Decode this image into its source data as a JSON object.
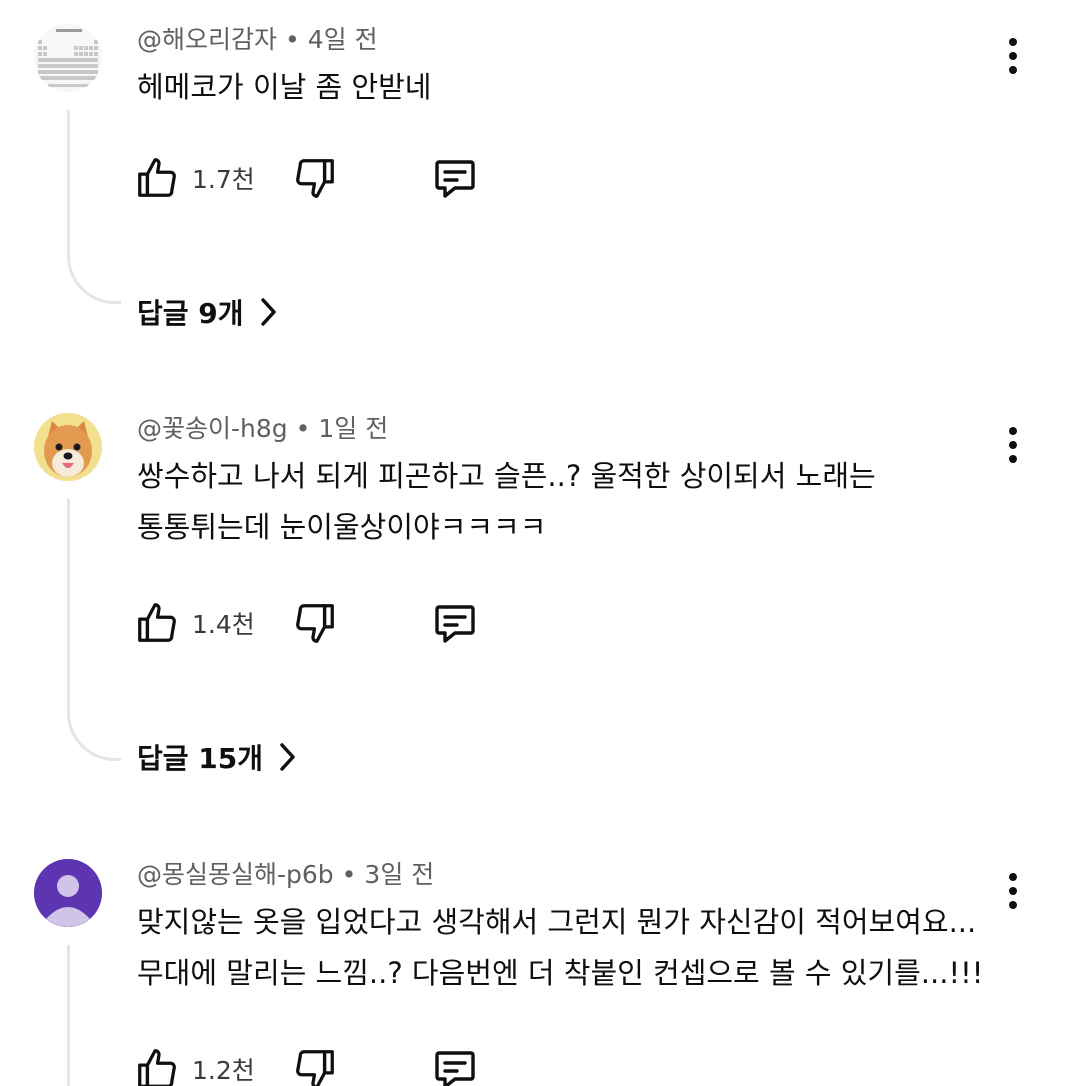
{
  "comments": [
    {
      "author": "@해오리감자",
      "age": "4일 전",
      "lines": [
        "헤메코가 이날 좀 안받네"
      ],
      "likes": "1.7천",
      "replies_label": "답글 9개",
      "avatar": "periodic-table-image"
    },
    {
      "author": "@꽃송이-h8g",
      "age": "1일 전",
      "lines": [
        "쌍수하고 나서 되게 피곤하고 슬픈..? 울적한 상이되서 노래는",
        "통통튀는데 눈이울상이야ㅋㅋㅋㅋ"
      ],
      "likes": "1.4천",
      "replies_label": "답글 15개",
      "avatar": "dog-photo"
    },
    {
      "author": "@몽실몽실해-p6b",
      "age": "3일 전",
      "lines": [
        "맞지않는 옷을 입었다고 생각해서 그런지 뭔가 자신감이 적어보여요...",
        "무대에 말리는 느낌..? 다음번엔 더 착붙인 컨셉으로 볼 수 있기를...!!!"
      ],
      "likes": "1.2천",
      "avatar": "default-person-avatar",
      "avatar_color": "#5e35b1"
    }
  ],
  "separator": "•",
  "icons": {
    "like": "thumbs-up-icon",
    "dislike": "thumbs-down-icon",
    "reply": "reply-comment-icon",
    "more": "more-vertical-icon",
    "chevron": "chevron-right-icon"
  }
}
